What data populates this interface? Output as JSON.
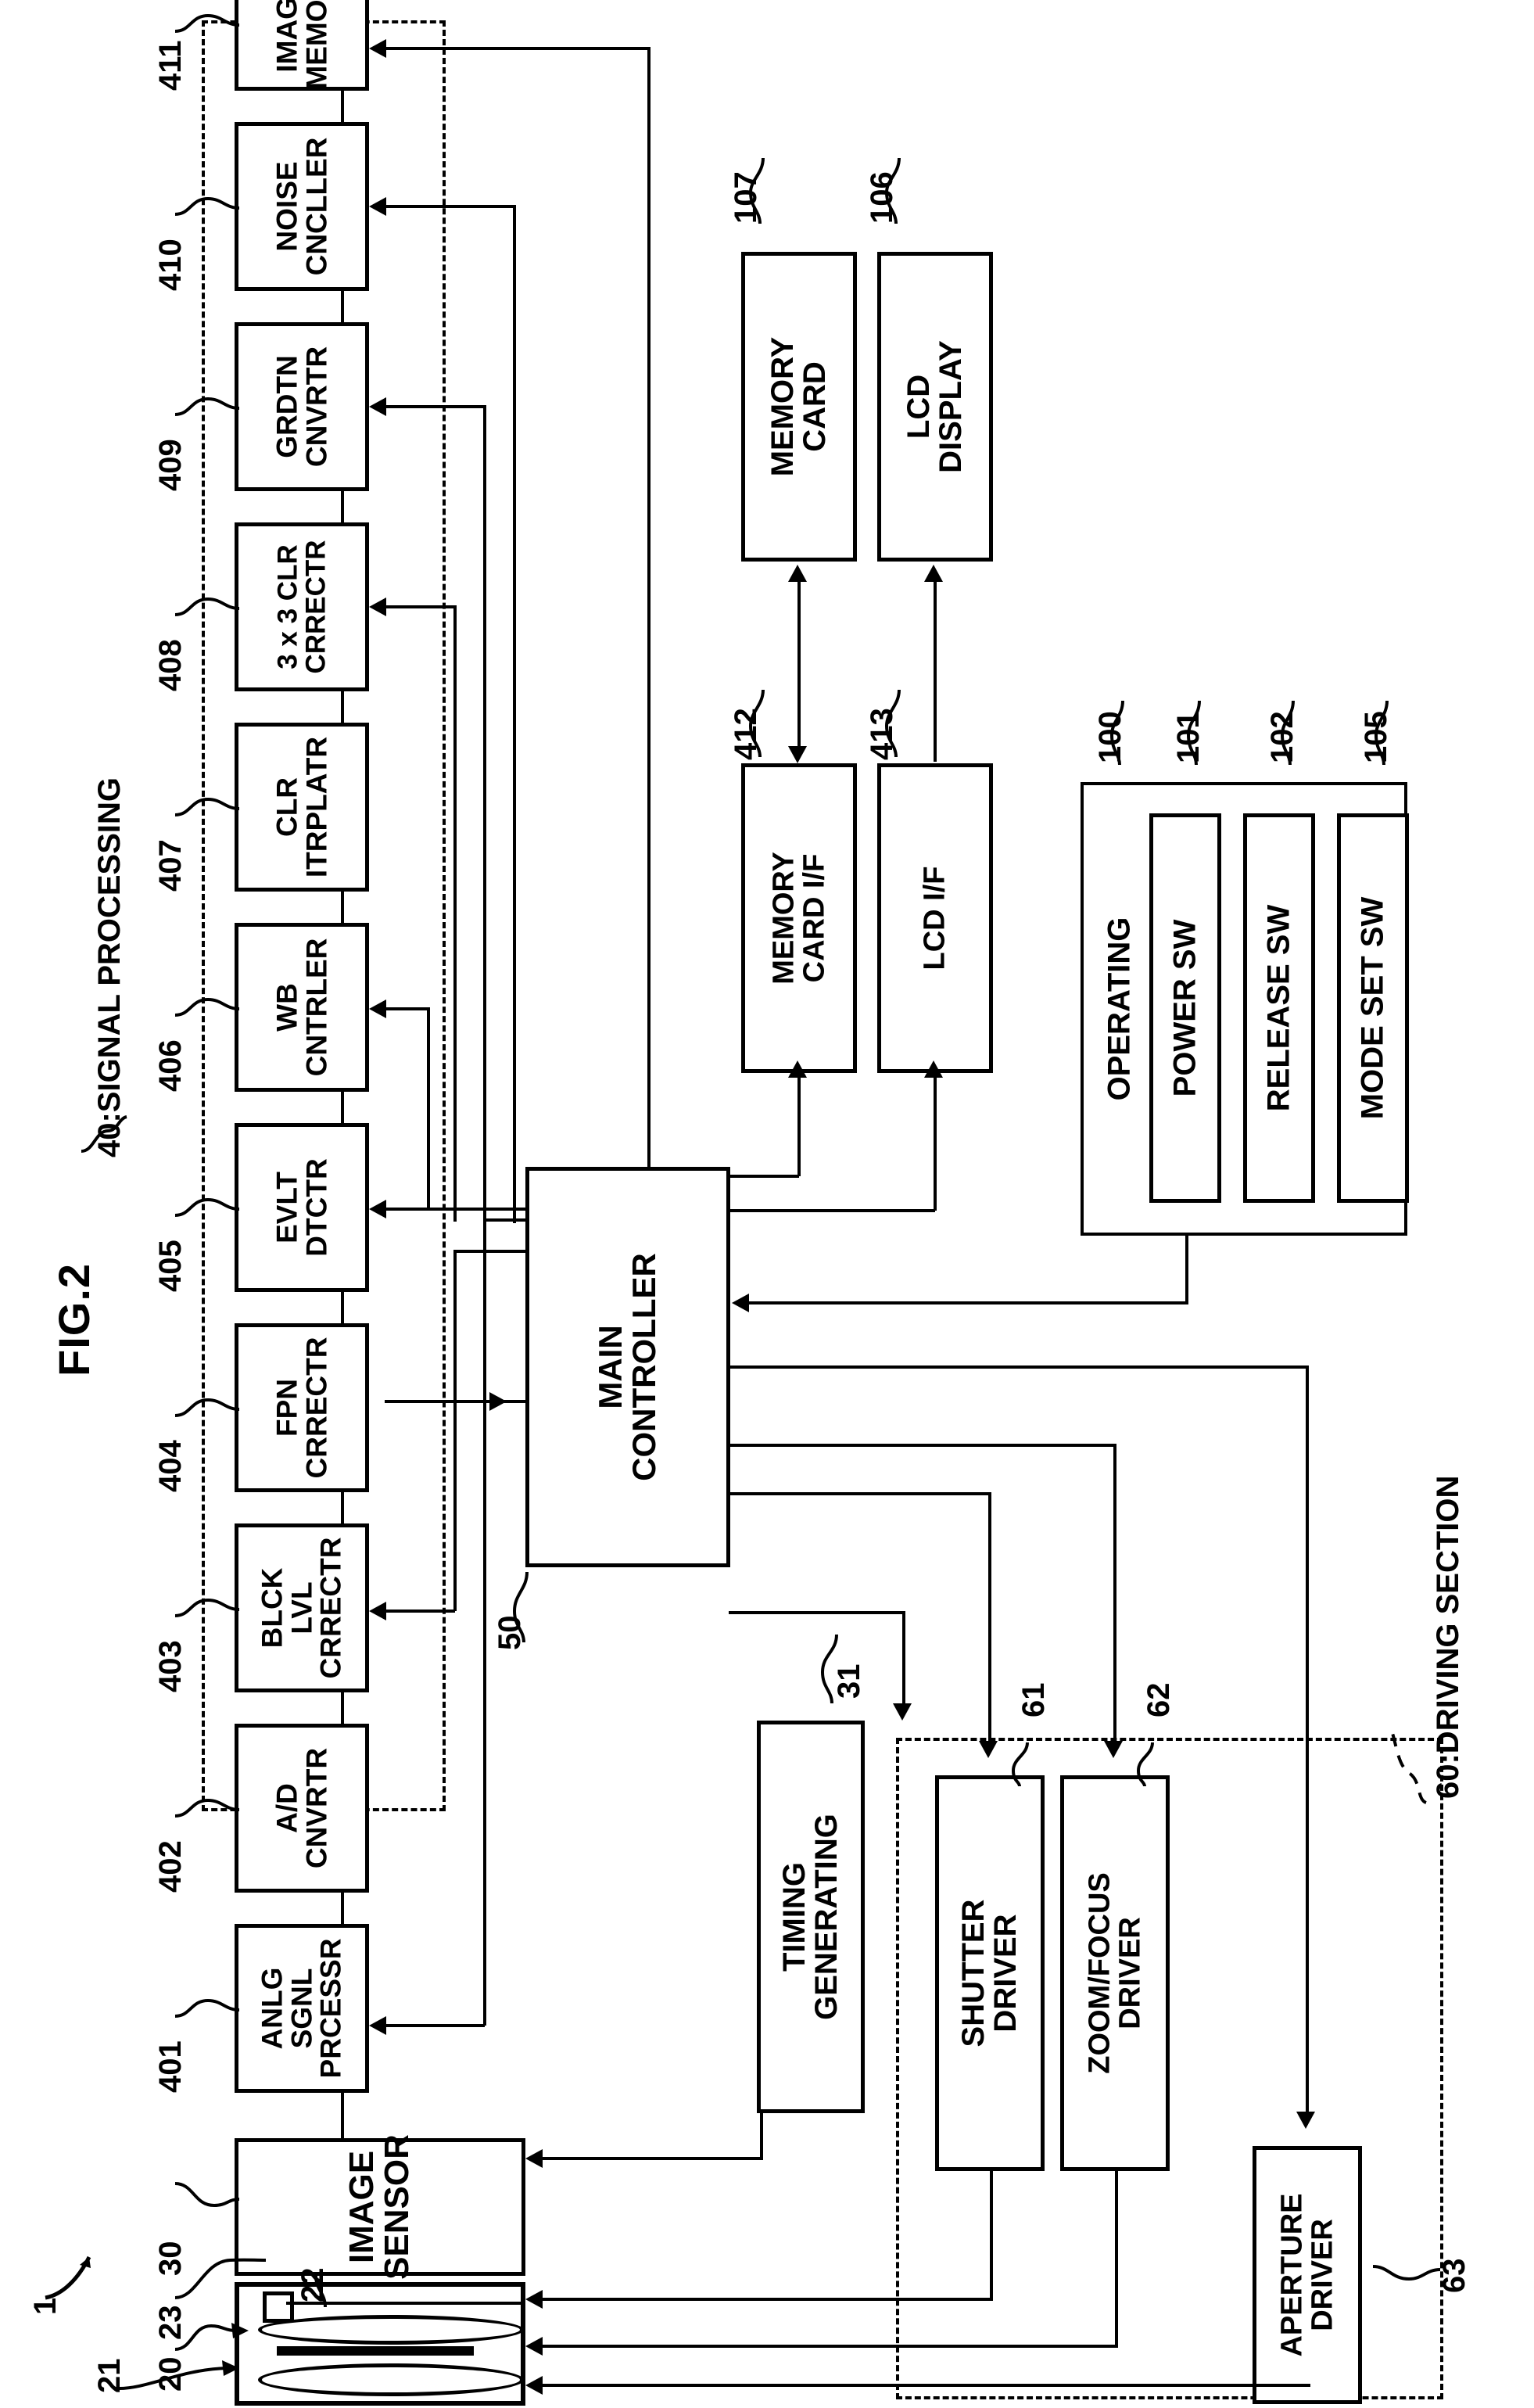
{
  "figure": {
    "title": "FIG.2",
    "signal_processing_label": "40:SIGNAL PROCESSING",
    "driving_section_label": "60:DRIVING SECTION",
    "device_ref": "1"
  },
  "signal_processing": {
    "ref": "40",
    "blocks": [
      {
        "ref": "401",
        "line1": "ANLG",
        "line2": "SGNL",
        "line3": "PRCESSR"
      },
      {
        "ref": "402",
        "line1": "A/D",
        "line2": "CNVRTR",
        "line3": ""
      },
      {
        "ref": "403",
        "line1": "BLCK",
        "line2": "LVL",
        "line3": "CRRECTR"
      },
      {
        "ref": "404",
        "line1": "FPN",
        "line2": "CRRECTR",
        "line3": ""
      },
      {
        "ref": "405",
        "line1": "EVLT",
        "line2": "DTCTR",
        "line3": ""
      },
      {
        "ref": "406",
        "line1": "WB",
        "line2": "CNTRLER",
        "line3": ""
      },
      {
        "ref": "407",
        "line1": "CLR",
        "line2": "ITRPLATR",
        "line3": ""
      },
      {
        "ref": "408",
        "line1": "3 x 3 CLR",
        "line2": "CRRECTR",
        "line3": ""
      },
      {
        "ref": "409",
        "line1": "GRDTN",
        "line2": "CNVRTR",
        "line3": ""
      },
      {
        "ref": "410",
        "line1": "NOISE",
        "line2": "CNCLLER",
        "line3": ""
      },
      {
        "ref": "411",
        "line1": "IMAGE",
        "line2": "MEMORY",
        "line3": ""
      }
    ]
  },
  "controller": {
    "ref": "50",
    "line1": "MAIN",
    "line2": "CONTROLLER"
  },
  "timing": {
    "ref": "31",
    "line1": "TIMING",
    "line2": "GENERATING"
  },
  "sensor": {
    "ref": "30",
    "line1": "IMAGE",
    "line2": "SENSOR"
  },
  "optics": {
    "lens_unit_ref": "20",
    "front_lens_ref": "21",
    "aperture_ref": "22",
    "shutter_ref": "23"
  },
  "interfaces": [
    {
      "ref": "412",
      "line1": "MEMORY",
      "line2": "CARD I/F"
    },
    {
      "ref": "413",
      "line1": "LCD I/F",
      "line2": ""
    }
  ],
  "peripherals": [
    {
      "ref": "107",
      "line1": "MEMORY",
      "line2": "CARD"
    },
    {
      "ref": "106",
      "line1": "LCD",
      "line2": "DISPLAY"
    }
  ],
  "operating": {
    "ref": "100",
    "label": "OPERATING",
    "switches": [
      {
        "ref": "101",
        "label": "POWER SW"
      },
      {
        "ref": "102",
        "label": "RELEASE SW"
      },
      {
        "ref": "105",
        "label": "MODE SET SW"
      }
    ]
  },
  "driving": {
    "ref": "60",
    "blocks": [
      {
        "ref": "61",
        "line1": "SHUTTER",
        "line2": "DRIVER"
      },
      {
        "ref": "62",
        "line1": "ZOOM/FOCUS",
        "line2": "DRIVER"
      },
      {
        "ref": "63",
        "line1": "APERTURE",
        "line2": "DRIVER"
      }
    ]
  }
}
